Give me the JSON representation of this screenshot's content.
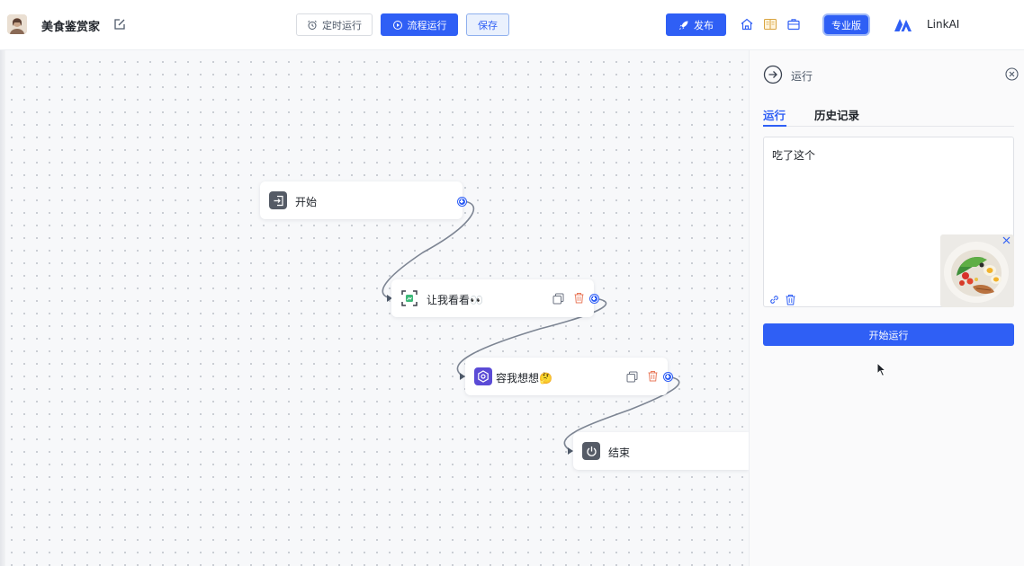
{
  "header": {
    "app_title": "美食鉴赏家",
    "schedule_label": "定时运行",
    "flow_run_label": "流程运行",
    "save_label": "保存",
    "publish_label": "发布",
    "pro_label": "专业版",
    "brand_name": "LinkAI"
  },
  "nodes": {
    "start": "开始",
    "look": "让我看看👀",
    "think": "容我想想🤔",
    "end": "结束"
  },
  "panel": {
    "title": "运行",
    "tabs": [
      "运行",
      "历史记录"
    ],
    "input_value": "吃了这个",
    "run_button": "开始运行"
  },
  "colors": {
    "accent": "#2f5ff5",
    "delete": "#e8795b"
  }
}
